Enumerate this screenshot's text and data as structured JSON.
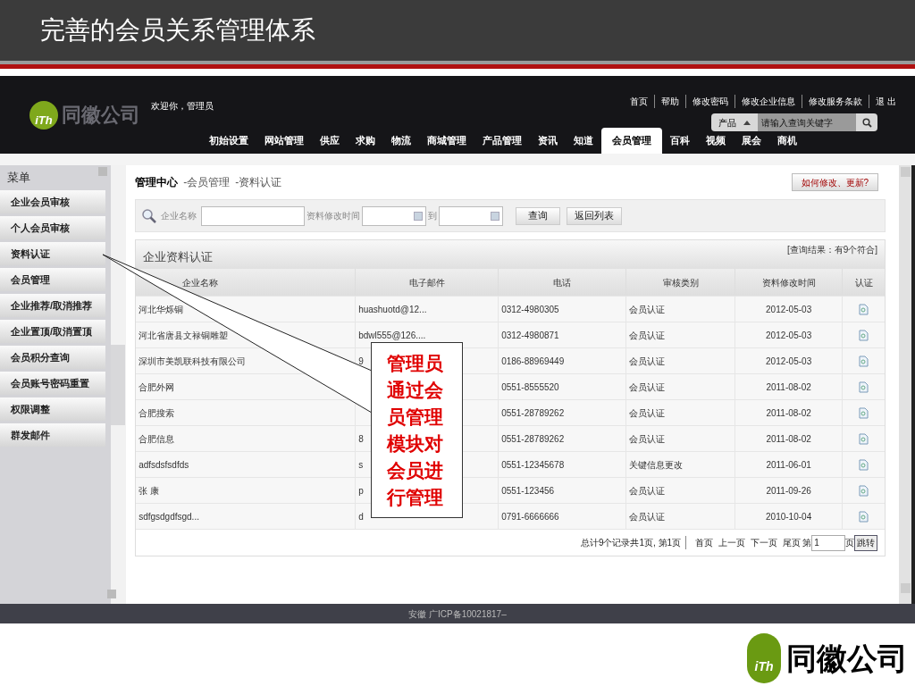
{
  "slide_title": "完善的会员关系管理体系",
  "header": {
    "logo_mark": "iTh",
    "logo_text": "同徽公司",
    "welcome": "欢迎你，管理员",
    "top_links": [
      "首页",
      "帮助",
      "修改密码",
      "修改企业信息",
      "修改服务条款",
      "退 出"
    ],
    "search": {
      "category": "产品",
      "placeholder": "请输入查询关键字"
    },
    "nav": [
      {
        "label": "初始设置",
        "selected": false
      },
      {
        "label": "网站管理",
        "selected": false
      },
      {
        "label": "供应",
        "selected": false
      },
      {
        "label": "求购",
        "selected": false
      },
      {
        "label": "物流",
        "selected": false
      },
      {
        "label": "商城管理",
        "selected": false
      },
      {
        "label": "产品管理",
        "selected": false
      },
      {
        "label": "资讯",
        "selected": false
      },
      {
        "label": "知道",
        "selected": false
      },
      {
        "label": "会员管理",
        "selected": true
      },
      {
        "label": "百科",
        "selected": false
      },
      {
        "label": "视频",
        "selected": false
      },
      {
        "label": "展会",
        "selected": false
      },
      {
        "label": "商机",
        "selected": false
      }
    ]
  },
  "sidebar": {
    "title": "菜单",
    "items": [
      "企业会员审核",
      "个人会员审核",
      "资料认证",
      "会员管理",
      "企业推荐/取消推荐",
      "企业置顶/取消置顶",
      "会员积分查询",
      "会员账号密码重置",
      "权限调整",
      "群发邮件"
    ]
  },
  "breadcrumb": {
    "root": "管理中心",
    "parts": [
      "-会员管理",
      "-资料认证"
    ]
  },
  "help_button": "如何修改、更新?",
  "filter": {
    "name_label": "企业名称",
    "time_label": "资料修改时间",
    "to_label": "到",
    "buttons": [
      "查询",
      "返回列表"
    ]
  },
  "panel": {
    "title": "企业资料认证",
    "result": "[查询结果：有9个符合]"
  },
  "table": {
    "columns": [
      "企业名称",
      "电子邮件",
      "电话",
      "审核类别",
      "资料修改时间",
      "认证"
    ],
    "rows": [
      {
        "name": "河北华烁铜",
        "email": "huashuotd@12...",
        "phone": "0312-4980305",
        "type": "会员认证",
        "date": "2012-05-03"
      },
      {
        "name": "河北省唐县文禄铜雕塑",
        "email": "bdwl555@126....",
        "phone": "0312-4980871",
        "type": "会员认证",
        "date": "2012-05-03"
      },
      {
        "name": "深圳市美凯联科技有限公司",
        "email": "9",
        "phone": "0186-88969449",
        "type": "会员认证",
        "date": "2012-05-03"
      },
      {
        "name": "合肥外网",
        "phone": "0551-8555520",
        "type": "会员认证",
        "date": "2011-08-02"
      },
      {
        "name": "合肥搜索",
        "phone": "0551-28789262",
        "type": "会员认证",
        "date": "2011-08-02"
      },
      {
        "name": "合肥信息",
        "email": "8",
        "phone": "0551-28789262",
        "type": "会员认证",
        "date": "2011-08-02"
      },
      {
        "name": "adfsdsfsdfds",
        "email": "s",
        "phone": "0551-12345678",
        "type": "关键信息更改",
        "date": "2011-06-01"
      },
      {
        "name": "张 康",
        "email": "p",
        "phone": "0551-123456",
        "type": "会员认证",
        "date": "2011-09-26"
      },
      {
        "name": "sdfgsdgdfsgd...",
        "email": "d",
        "phone": "0791-6666666",
        "type": "会员认证",
        "date": "2010-10-04"
      }
    ]
  },
  "pagination": {
    "summary": "总计9个记录共1页, 第1页",
    "links": [
      "首页",
      "上一页",
      "下一页",
      "尾页"
    ],
    "page_prefix": "第",
    "page_value": "1",
    "page_suffix": "页",
    "go": "跳转"
  },
  "footer": "安徽 广ICP备10021817–",
  "callout": "管理员通过会员管理模块对会员进行管理",
  "slide_logo": {
    "mark": "iTh",
    "text": "同徽公司"
  }
}
